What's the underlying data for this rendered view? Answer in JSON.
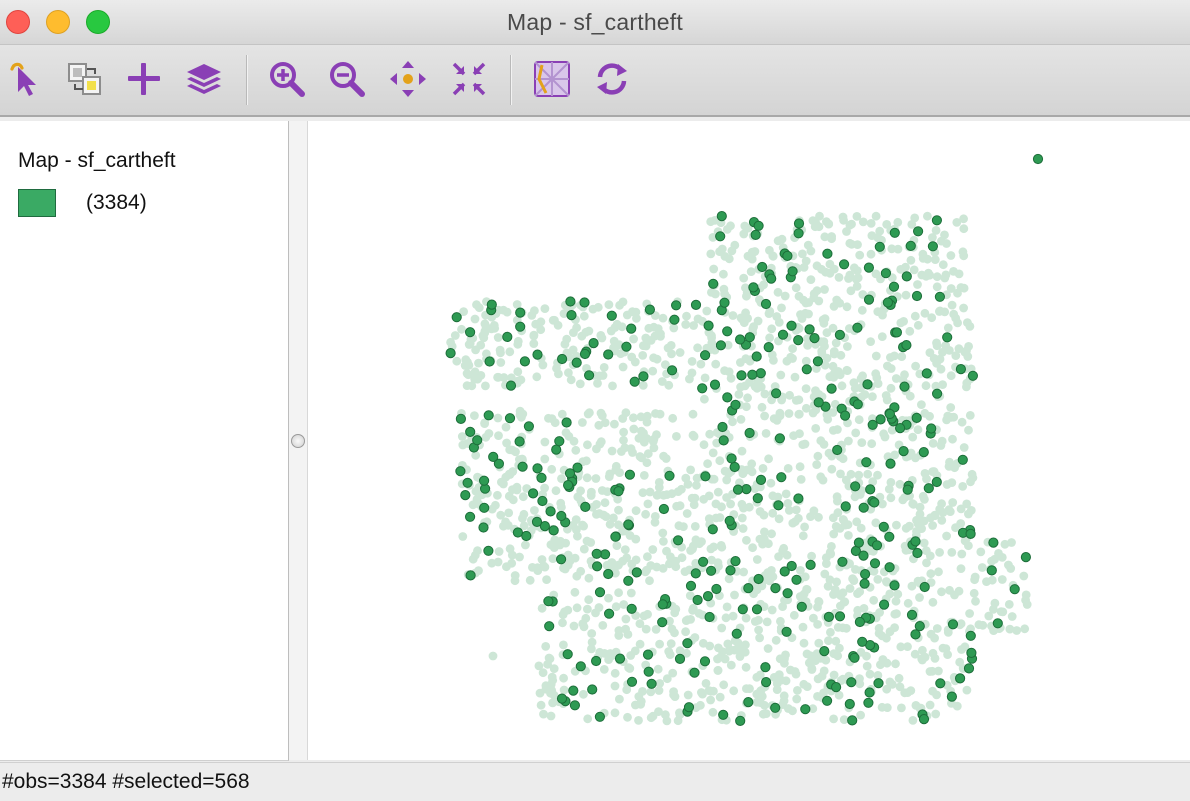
{
  "window": {
    "title": "Map - sf_cartheft",
    "controls": {
      "close_color": "#fe5f57",
      "minimize_color": "#febc2e",
      "maximize_color": "#28c840"
    }
  },
  "toolbar": {
    "tools": [
      {
        "name": "select-tool",
        "icon": "pointer-select-icon"
      },
      {
        "name": "selection-shape-tool",
        "icon": "select-shape-icon"
      },
      {
        "name": "add-layer-tool",
        "icon": "plus-icon"
      },
      {
        "name": "layers-tool",
        "icon": "layers-icon"
      },
      {
        "name": "zoom-in-tool",
        "icon": "zoom-in-icon"
      },
      {
        "name": "zoom-out-tool",
        "icon": "zoom-out-icon"
      },
      {
        "name": "pan-tool",
        "icon": "pan-arrows-icon"
      },
      {
        "name": "full-extent-tool",
        "icon": "fit-extent-icon"
      },
      {
        "name": "basemap-tool",
        "icon": "basemap-icon"
      },
      {
        "name": "refresh-tool",
        "icon": "refresh-icon"
      }
    ],
    "icon_color": "#8a3fb5"
  },
  "legend": {
    "title": "Map - sf_cartheft",
    "items": [
      {
        "count_label": "(3384)",
        "color": "#3aaa64"
      }
    ]
  },
  "map": {
    "selected_color": "#2e9a53",
    "selected_stroke": "#1d6e3a",
    "unselected_color": "#cde6d6"
  },
  "status": {
    "text": "#obs=3384 #selected=568"
  }
}
